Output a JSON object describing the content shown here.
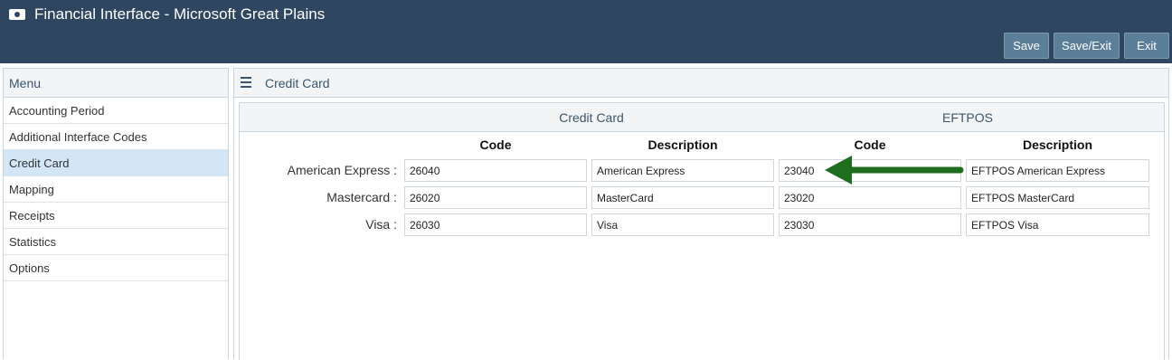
{
  "window": {
    "title": "Financial Interface - Microsoft Great Plains",
    "icon": "money-icon"
  },
  "toolbar": {
    "save_label": "Save",
    "save_exit_label": "Save/Exit",
    "exit_label": "Exit"
  },
  "sidebar": {
    "header": "Menu",
    "items": [
      {
        "label": "Accounting Period"
      },
      {
        "label": "Additional Interface Codes"
      },
      {
        "label": "Credit Card",
        "active": true
      },
      {
        "label": "Mapping"
      },
      {
        "label": "Receipts"
      },
      {
        "label": "Statistics"
      },
      {
        "label": "Options"
      }
    ]
  },
  "panel": {
    "title": "Credit Card",
    "groups": {
      "credit_card": "Credit Card",
      "eftpos": "EFTPOS"
    },
    "columns": {
      "cc_code": "Code",
      "cc_description": "Description",
      "ef_code": "Code",
      "ef_description": "Description"
    },
    "rows": [
      {
        "label": "American Express :",
        "cc_code": "26040",
        "cc_description": "American Express",
        "ef_code": "23040",
        "ef_description": "EFTPOS American Express"
      },
      {
        "label": "Mastercard :",
        "cc_code": "26020",
        "cc_description": "MasterCard",
        "ef_code": "23020",
        "ef_description": "EFTPOS MasterCard"
      },
      {
        "label": "Visa :",
        "cc_code": "26030",
        "cc_description": "Visa",
        "ef_code": "23030",
        "ef_description": "EFTPOS Visa"
      }
    ]
  },
  "colors": {
    "header_bg": "#2f4661",
    "button_bg": "#5b7f98",
    "active_item": "#d3e6f6",
    "annotation_arrow": "#1f6e1f"
  }
}
